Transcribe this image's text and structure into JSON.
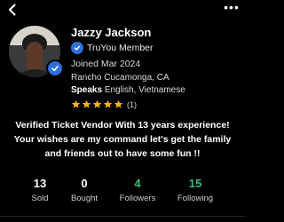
{
  "header": {
    "back_icon": "chevron-left-icon",
    "more_icon": "more-horizontal-icon"
  },
  "profile": {
    "name": "Jazzy Jackson",
    "member_label": "TruYou Member",
    "joined": "Joined Mar 2024",
    "location": "Rancho Cucamonga, CA",
    "speaks_label": "Speaks",
    "languages": "English, Vietnamese",
    "rating_value": 5,
    "rating_max": 5,
    "rating_count": "(1)",
    "bio": "Verified Ticket Vendor With 13 years experience! Your wishes are my command let's get the family and friends out to have some fun !!"
  },
  "stats": [
    {
      "value": "13",
      "label": "Sold"
    },
    {
      "value": "0",
      "label": "Bought"
    },
    {
      "value": "4",
      "label": "Followers"
    },
    {
      "value": "15",
      "label": "Following"
    }
  ],
  "colors": {
    "background": "#000000",
    "verified_blue": "#2f6fd6",
    "star_yellow": "#f5b301",
    "follow_green": "#35c07a"
  }
}
